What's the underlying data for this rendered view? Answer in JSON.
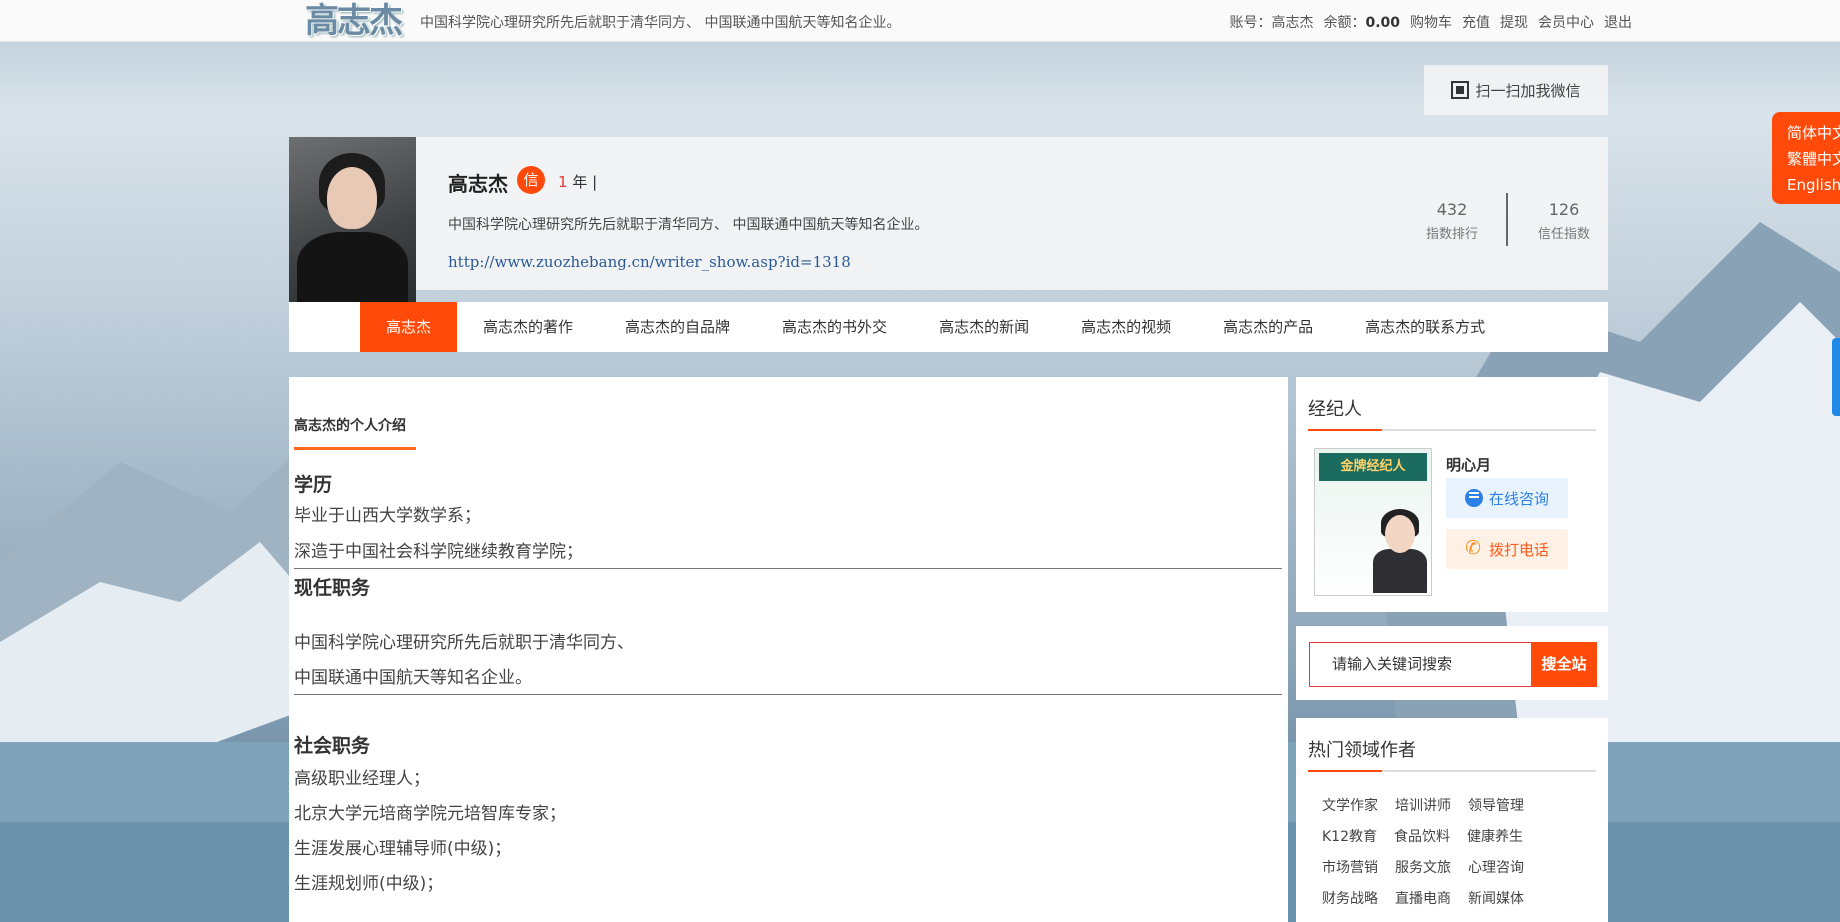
{
  "header": {
    "logo": "高志杰",
    "slogan": "中国科学院心理研究所先后就职于清华同方、 中国联通中国航天等知名企业。",
    "account_label": "账号：",
    "account_name": "高志杰",
    "balance_label": "余额：",
    "balance_value": "0.00",
    "links": [
      "购物车",
      "充值",
      "提现",
      "会员中心",
      "退出"
    ]
  },
  "wechat_button": "扫一扫加我微信",
  "language_switch": [
    "简体中文",
    "繁體中文",
    "English"
  ],
  "profile": {
    "name": "高志杰",
    "badge": "信",
    "years_num": "1",
    "years_text": "年 |",
    "description": "中国科学院心理研究所先后就职于清华同方、 中国联通中国航天等知名企业。",
    "url": "http://www.zuozhebang.cn/writer_show.asp?id=1318",
    "stats": [
      {
        "value": "432",
        "label": "指数排行"
      },
      {
        "value": "126",
        "label": "信任指数"
      }
    ]
  },
  "nav": [
    "高志杰",
    "高志杰的著作",
    "高志杰的自品牌",
    "高志杰的书外交",
    "高志杰的新闻",
    "高志杰的视频",
    "高志杰的产品",
    "高志杰的联系方式"
  ],
  "main": {
    "section_title": "高志杰的个人介绍",
    "education_heading": "学历",
    "education": [
      "毕业于山西大学数学系；",
      "深造于中国社会科学院继续教育学院；"
    ],
    "current_heading": "现任职务",
    "current": [
      "中国科学院心理研究所先后就职于清华同方、",
      "中国联通中国航天等知名企业。"
    ],
    "social_heading": "社会职务",
    "social": [
      "高级职业经理人；",
      "北京大学元培商学院元培智库专家；",
      "生涯发展心理辅导师(中级)；",
      "生涯规划师(中级)；"
    ]
  },
  "agent": {
    "heading": "经纪人",
    "card_title": "金牌经纪人",
    "name": "明心月",
    "consult_label": "在线咨询",
    "call_label": "拨打电话"
  },
  "search": {
    "placeholder": "请输入关键词搜索",
    "button": "搜全站"
  },
  "hot": {
    "heading": "热门领域作者",
    "tags": [
      [
        "文学作家",
        "培训讲师",
        "领导管理"
      ],
      [
        "K12教育",
        "食品饮料",
        "健康养生"
      ],
      [
        "市场营销",
        "服务文旅",
        "心理咨询"
      ],
      [
        "财务战略",
        "直播电商",
        "新闻媒体"
      ]
    ]
  }
}
